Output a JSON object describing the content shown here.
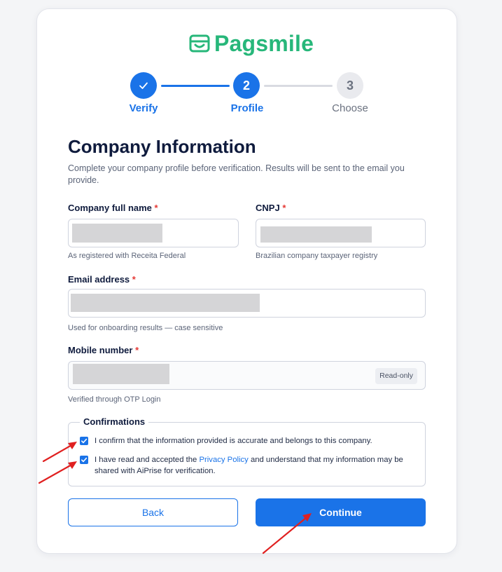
{
  "brand": {
    "name": "Pagsmile",
    "color": "#27b77a"
  },
  "stepper": {
    "steps": [
      {
        "number": "",
        "label": "Verify",
        "state": "completed",
        "icon": "check-icon"
      },
      {
        "number": "2",
        "label": "Profile",
        "state": "active"
      },
      {
        "number": "3",
        "label": "Choose",
        "state": "upcoming"
      }
    ]
  },
  "form": {
    "title": "Company Information",
    "subtitle": "Complete your company profile before verification. Results will be sent to the email you provide.",
    "fields": {
      "company_name": {
        "label": "Company full name",
        "required": "*",
        "hint": "As registered with Receita Federal"
      },
      "cnpj": {
        "label": "CNPJ",
        "required": "*",
        "hint": "Brazilian company taxpayer registry"
      },
      "email": {
        "label": "Email address",
        "required": "*",
        "hint": "Used for onboarding results — case sensitive"
      },
      "mobile": {
        "label": "Mobile number",
        "required": "*",
        "hint": "Verified through OTP Login",
        "badge": "Read-only"
      }
    },
    "confirmations": {
      "legend": "Confirmations",
      "item1": {
        "text": "I confirm that the information provided is accurate and belongs to this company.",
        "checked": true
      },
      "item2": {
        "text_before": "I have read and accepted the",
        "link": "Privacy Policy",
        "text_after": "and understand that my information may be shared with AiPrise for verification.",
        "checked": true
      }
    }
  },
  "buttons": {
    "back": "Back",
    "continue": "Continue"
  },
  "colors": {
    "primary": "#1a73e8",
    "annotation_arrow": "#e02020",
    "required": "#e53935"
  }
}
